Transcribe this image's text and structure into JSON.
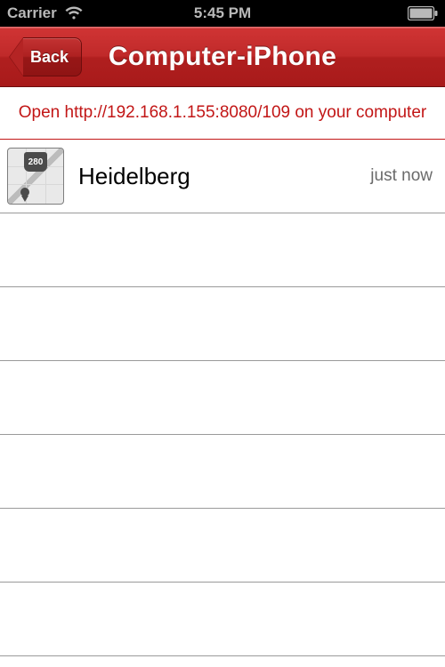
{
  "status_bar": {
    "carrier": "Carrier",
    "time": "5:45 PM"
  },
  "nav": {
    "back_label": "Back",
    "title": "Computer-iPhone"
  },
  "info_banner": {
    "text": "Open http://192.168.1.155:8080/109 on your computer"
  },
  "list": {
    "items": [
      {
        "thumb_badge": "280",
        "title": "Heidelberg",
        "time": "just now"
      }
    ],
    "empty_row_count": 6
  }
}
